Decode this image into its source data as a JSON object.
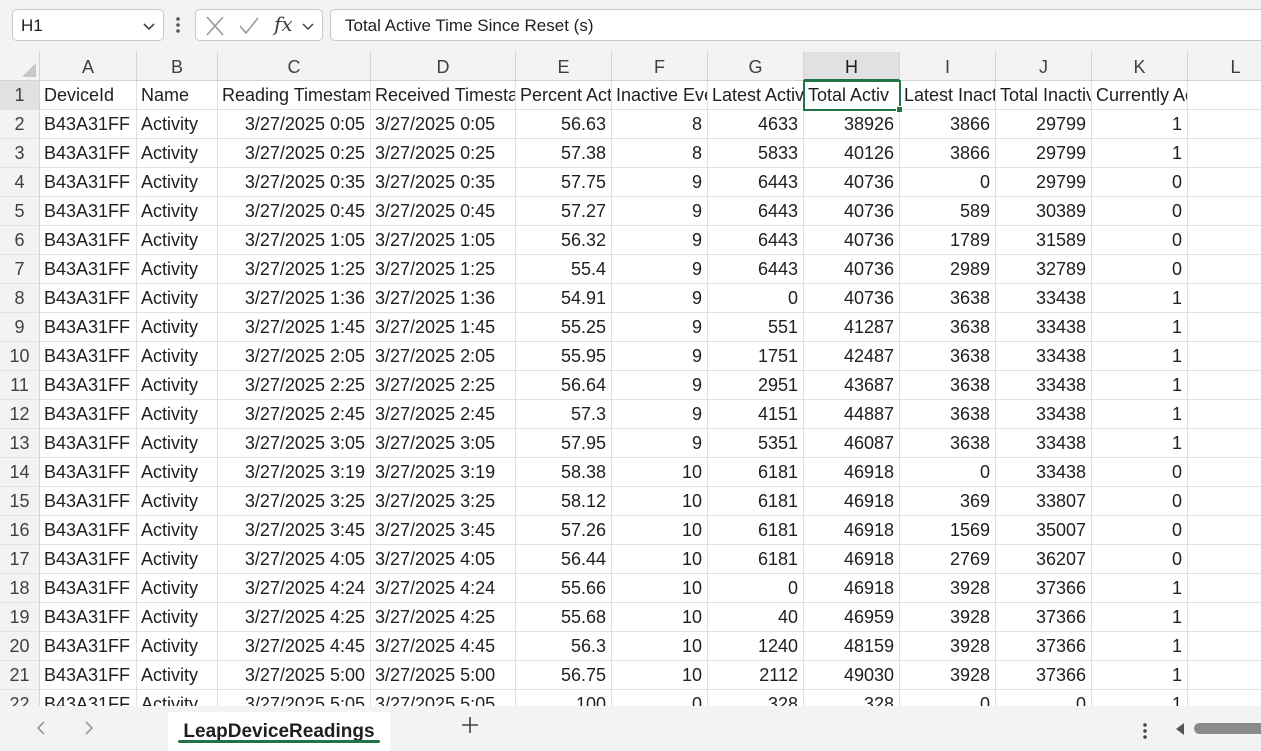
{
  "formula_bar": {
    "name_box": "H1",
    "fx_label": "fx",
    "formula": "Total Active Time Since Reset (s)"
  },
  "columns": [
    "A",
    "B",
    "C",
    "D",
    "E",
    "F",
    "G",
    "H",
    "I",
    "J",
    "K",
    "L"
  ],
  "selected_column": "H",
  "selected_row": "1",
  "header_row": {
    "num": "1",
    "cells": [
      "DeviceId",
      "Name",
      "Reading Timestamp",
      "Received Timestamp",
      "Percent Active",
      "Inactive Events",
      "Latest Active",
      "Total Activ",
      "Latest Inactive",
      "Total Inactive",
      "Currently Active",
      ""
    ]
  },
  "rows": [
    {
      "num": "2",
      "cells": [
        "B43A31FF",
        "Activity",
        "3/27/2025 0:05",
        "3/27/2025 0:05",
        "56.63",
        "8",
        "4633",
        "38926",
        "3866",
        "29799",
        "1",
        ""
      ]
    },
    {
      "num": "3",
      "cells": [
        "B43A31FF",
        "Activity",
        "3/27/2025 0:25",
        "3/27/2025 0:25",
        "57.38",
        "8",
        "5833",
        "40126",
        "3866",
        "29799",
        "1",
        ""
      ]
    },
    {
      "num": "4",
      "cells": [
        "B43A31FF",
        "Activity",
        "3/27/2025 0:35",
        "3/27/2025 0:35",
        "57.75",
        "9",
        "6443",
        "40736",
        "0",
        "29799",
        "0",
        ""
      ]
    },
    {
      "num": "5",
      "cells": [
        "B43A31FF",
        "Activity",
        "3/27/2025 0:45",
        "3/27/2025 0:45",
        "57.27",
        "9",
        "6443",
        "40736",
        "589",
        "30389",
        "0",
        ""
      ]
    },
    {
      "num": "6",
      "cells": [
        "B43A31FF",
        "Activity",
        "3/27/2025 1:05",
        "3/27/2025 1:05",
        "56.32",
        "9",
        "6443",
        "40736",
        "1789",
        "31589",
        "0",
        ""
      ]
    },
    {
      "num": "7",
      "cells": [
        "B43A31FF",
        "Activity",
        "3/27/2025 1:25",
        "3/27/2025 1:25",
        "55.4",
        "9",
        "6443",
        "40736",
        "2989",
        "32789",
        "0",
        ""
      ]
    },
    {
      "num": "8",
      "cells": [
        "B43A31FF",
        "Activity",
        "3/27/2025 1:36",
        "3/27/2025 1:36",
        "54.91",
        "9",
        "0",
        "40736",
        "3638",
        "33438",
        "1",
        ""
      ]
    },
    {
      "num": "9",
      "cells": [
        "B43A31FF",
        "Activity",
        "3/27/2025 1:45",
        "3/27/2025 1:45",
        "55.25",
        "9",
        "551",
        "41287",
        "3638",
        "33438",
        "1",
        ""
      ]
    },
    {
      "num": "10",
      "cells": [
        "B43A31FF",
        "Activity",
        "3/27/2025 2:05",
        "3/27/2025 2:05",
        "55.95",
        "9",
        "1751",
        "42487",
        "3638",
        "33438",
        "1",
        ""
      ]
    },
    {
      "num": "11",
      "cells": [
        "B43A31FF",
        "Activity",
        "3/27/2025 2:25",
        "3/27/2025 2:25",
        "56.64",
        "9",
        "2951",
        "43687",
        "3638",
        "33438",
        "1",
        ""
      ]
    },
    {
      "num": "12",
      "cells": [
        "B43A31FF",
        "Activity",
        "3/27/2025 2:45",
        "3/27/2025 2:45",
        "57.3",
        "9",
        "4151",
        "44887",
        "3638",
        "33438",
        "1",
        ""
      ]
    },
    {
      "num": "13",
      "cells": [
        "B43A31FF",
        "Activity",
        "3/27/2025 3:05",
        "3/27/2025 3:05",
        "57.95",
        "9",
        "5351",
        "46087",
        "3638",
        "33438",
        "1",
        ""
      ]
    },
    {
      "num": "14",
      "cells": [
        "B43A31FF",
        "Activity",
        "3/27/2025 3:19",
        "3/27/2025 3:19",
        "58.38",
        "10",
        "6181",
        "46918",
        "0",
        "33438",
        "0",
        ""
      ]
    },
    {
      "num": "15",
      "cells": [
        "B43A31FF",
        "Activity",
        "3/27/2025 3:25",
        "3/27/2025 3:25",
        "58.12",
        "10",
        "6181",
        "46918",
        "369",
        "33807",
        "0",
        ""
      ]
    },
    {
      "num": "16",
      "cells": [
        "B43A31FF",
        "Activity",
        "3/27/2025 3:45",
        "3/27/2025 3:45",
        "57.26",
        "10",
        "6181",
        "46918",
        "1569",
        "35007",
        "0",
        ""
      ]
    },
    {
      "num": "17",
      "cells": [
        "B43A31FF",
        "Activity",
        "3/27/2025 4:05",
        "3/27/2025 4:05",
        "56.44",
        "10",
        "6181",
        "46918",
        "2769",
        "36207",
        "0",
        ""
      ]
    },
    {
      "num": "18",
      "cells": [
        "B43A31FF",
        "Activity",
        "3/27/2025 4:24",
        "3/27/2025 4:24",
        "55.66",
        "10",
        "0",
        "46918",
        "3928",
        "37366",
        "1",
        ""
      ]
    },
    {
      "num": "19",
      "cells": [
        "B43A31FF",
        "Activity",
        "3/27/2025 4:25",
        "3/27/2025 4:25",
        "55.68",
        "10",
        "40",
        "46959",
        "3928",
        "37366",
        "1",
        ""
      ]
    },
    {
      "num": "20",
      "cells": [
        "B43A31FF",
        "Activity",
        "3/27/2025 4:45",
        "3/27/2025 4:45",
        "56.3",
        "10",
        "1240",
        "48159",
        "3928",
        "37366",
        "1",
        ""
      ]
    },
    {
      "num": "21",
      "cells": [
        "B43A31FF",
        "Activity",
        "3/27/2025 5:00",
        "3/27/2025 5:00",
        "56.75",
        "10",
        "2112",
        "49030",
        "3928",
        "37366",
        "1",
        ""
      ]
    },
    {
      "num": "22",
      "cells": [
        "B43A31FF",
        "Activity",
        "3/27/2025 5:05",
        "3/27/2025 5:05",
        "100",
        "0",
        "328",
        "328",
        "0",
        "0",
        "1",
        ""
      ]
    }
  ],
  "sheet_tabs": {
    "active": "LeapDeviceReadings"
  },
  "colors": {
    "accent": "#217346",
    "header_bg": "#f3f3f3",
    "selected_header_bg": "#e1e1e1",
    "gridline": "#e1e1e1"
  },
  "icons": {
    "name_box_dropdown": "chevron-down-icon",
    "formula_more": "more-vertical-icon",
    "cancel": "close-icon",
    "enter": "check-icon",
    "function": "fx-icon",
    "prev_sheet": "chevron-left-icon",
    "next_sheet": "chevron-right-icon",
    "add_sheet": "plus-icon",
    "tabs_more": "more-vertical-icon",
    "scroll_left": "caret-left-icon"
  }
}
